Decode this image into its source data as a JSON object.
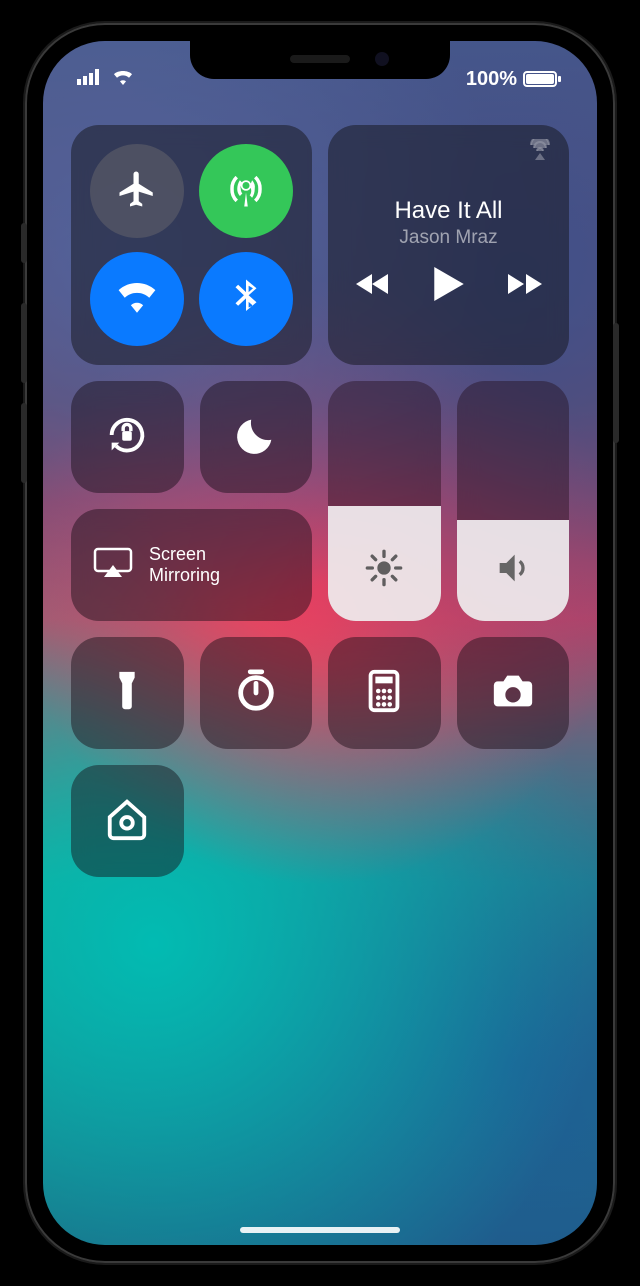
{
  "status": {
    "battery_text": "100%"
  },
  "music": {
    "title": "Have It All",
    "artist": "Jason Mraz"
  },
  "screen_mirroring": {
    "line1": "Screen",
    "line2": "Mirroring"
  },
  "sliders": {
    "brightness_percent": 48,
    "volume_percent": 42
  },
  "connectivity": {
    "airplane": false,
    "cellular": true,
    "wifi": true,
    "bluetooth": true
  },
  "toggles": {
    "orientation_lock": false,
    "do_not_disturb": false
  }
}
